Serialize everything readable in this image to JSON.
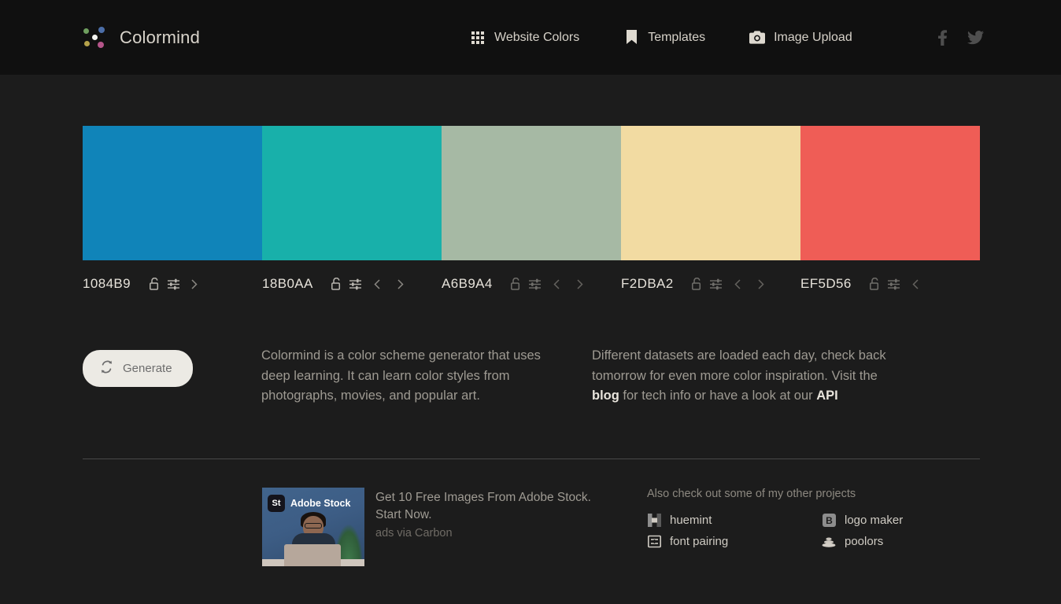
{
  "header": {
    "brand": "Colormind",
    "logo_icon": "colormind-dots-logo",
    "nav": [
      {
        "label": "Website Colors",
        "icon": "grid-icon"
      },
      {
        "label": "Templates",
        "icon": "bookmark-icon"
      },
      {
        "label": "Image Upload",
        "icon": "camera-icon"
      }
    ],
    "socials": [
      {
        "name": "facebook-icon",
        "label": "f"
      },
      {
        "name": "twitter-icon",
        "label": ""
      }
    ]
  },
  "palette": {
    "swatches": [
      {
        "hex": "1084B9",
        "css": "#1084B9",
        "locked": false,
        "has_prev": false,
        "has_next": true,
        "active": true
      },
      {
        "hex": "18B0AA",
        "css": "#18B0AA",
        "locked": false,
        "has_prev": true,
        "has_next": true,
        "active": true
      },
      {
        "hex": "A6B9A4",
        "css": "#A6B9A4",
        "locked": false,
        "has_prev": true,
        "has_next": true,
        "active": false
      },
      {
        "hex": "F2DBA2",
        "css": "#F2DBA2",
        "locked": false,
        "has_prev": true,
        "has_next": true,
        "active": false
      },
      {
        "hex": "EF5D56",
        "css": "#EF5D56",
        "locked": false,
        "has_prev": true,
        "has_next": false,
        "active": false
      }
    ],
    "lock_icon": "unlock-icon",
    "adjust_icon": "sliders-icon",
    "prev_icon": "chevron-left-icon",
    "next_icon": "chevron-right-icon"
  },
  "actions": {
    "generate_label": "Generate",
    "generate_icon": "refresh-icon"
  },
  "intro": {
    "left": "Colormind is a color scheme generator that uses deep learning. It can learn color styles from photographs, movies, and popular art.",
    "right_part1": "Different datasets are loaded each day, check back tomorrow for even more color inspiration. Visit the ",
    "right_link1": "blog",
    "right_part2": " for tech info or have a look at our ",
    "right_link2": "API"
  },
  "ad": {
    "thumb_logo_badge": "St",
    "thumb_logo_text": "Adobe Stock",
    "headline": "Get 10 Free Images From Adobe Stock. Start Now.",
    "attribution": "ads via Carbon"
  },
  "projects": {
    "title": "Also check out some of my other projects",
    "items": [
      {
        "label": "huemint",
        "icon": "huemint-icon"
      },
      {
        "label": "logo maker",
        "icon": "logo-maker-icon"
      },
      {
        "label": "font pairing",
        "icon": "font-pairing-icon"
      },
      {
        "label": "poolors",
        "icon": "poolors-icon"
      }
    ]
  },
  "colors": {
    "background": "#1c1c1c",
    "header_background": "#101010",
    "text_primary": "#d9d4cb",
    "text_muted": "#9e9a92",
    "divider": "#494949",
    "button_background": "#eceae4"
  }
}
